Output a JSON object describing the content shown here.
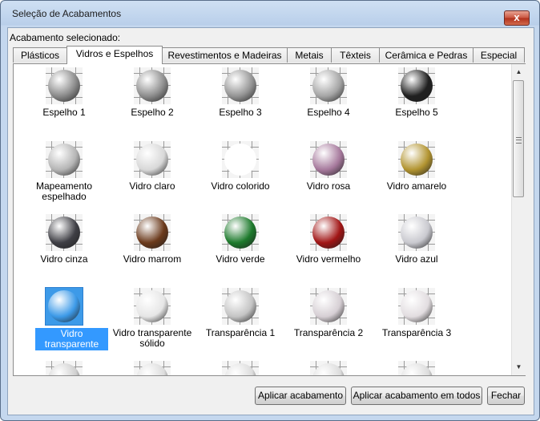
{
  "window": {
    "title": "Seleção de Acabamentos",
    "close_label": "x"
  },
  "selected_label": "Acabamento selecionado:",
  "tabs": [
    {
      "label": "Plásticos"
    },
    {
      "label": "Vidros e Espelhos",
      "active": true
    },
    {
      "label": "Revestimentos e Madeiras"
    },
    {
      "label": "Metais"
    },
    {
      "label": "Têxteis"
    },
    {
      "label": "Cerâmica e Pedras"
    },
    {
      "label": "Especial"
    }
  ],
  "materials": [
    {
      "label": "Espelho 1",
      "color": "#8a8a8a"
    },
    {
      "label": "Espelho 2",
      "color": "#8d8d8d"
    },
    {
      "label": "Espelho 3",
      "color": "#949494"
    },
    {
      "label": "Espelho 4",
      "color": "#a5a5a5"
    },
    {
      "label": "Espelho 5",
      "color": "#202020"
    },
    {
      "label": "Mapeamento espelhado",
      "color": "#b5b5b5"
    },
    {
      "label": "Vidro claro",
      "color": "#d8d8d8"
    },
    {
      "label": "Vidro colorido",
      "color": "#ffffff"
    },
    {
      "label": "Vidro rosa",
      "color": "#a6799c"
    },
    {
      "label": "Vidro amarelo",
      "color": "#b29430"
    },
    {
      "label": "Vidro cinza",
      "color": "#3f3f45"
    },
    {
      "label": "Vidro marrom",
      "color": "#6b3a1c"
    },
    {
      "label": "Vidro verde",
      "color": "#1d7a2c"
    },
    {
      "label": "Vidro vermelho",
      "color": "#a11515"
    },
    {
      "label": "Vidro azul",
      "color": "#c9c9cf"
    },
    {
      "label": "Vidro transparente",
      "color": "#3d9ae8",
      "selected": true
    },
    {
      "label": "Vidro transparente sólido",
      "color": "#e6e6e6"
    },
    {
      "label": "Transparência 1",
      "color": "#c4c4c4"
    },
    {
      "label": "Transparência 2",
      "color": "#d6cfd4"
    },
    {
      "label": "Transparência 3",
      "color": "#e2dde0"
    },
    {
      "label": "",
      "color": "#cfcfcf"
    },
    {
      "label": "",
      "color": "#dcdcdc"
    },
    {
      "label": "",
      "color": "#dcdcdc"
    },
    {
      "label": "",
      "color": "#dcdcdc"
    },
    {
      "label": "",
      "color": "#dcdcdc"
    }
  ],
  "buttons": {
    "apply": "Aplicar acabamento",
    "apply_all": "Aplicar acabamento em todos",
    "close": "Fechar"
  }
}
